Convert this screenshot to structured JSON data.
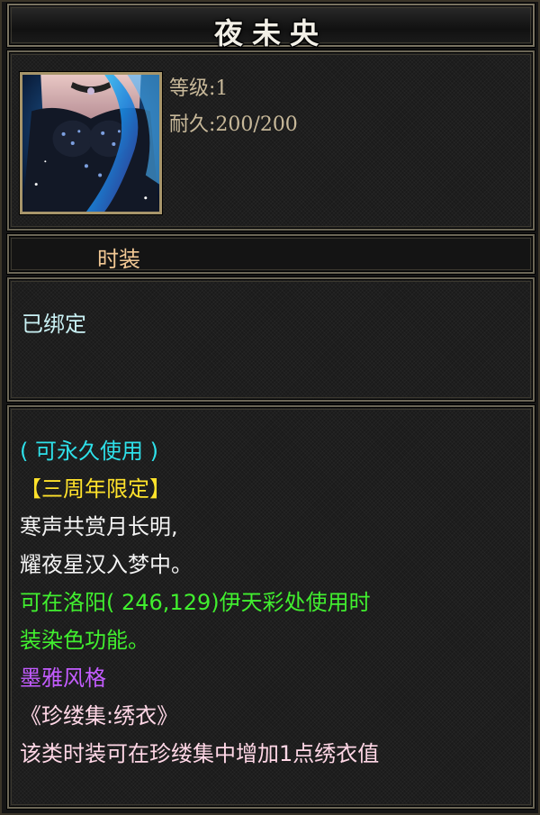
{
  "item": {
    "name": "夜未央",
    "level": "等级:1",
    "durability": "耐久:200/200",
    "category": "时装",
    "bind_status": "已绑定"
  },
  "description": {
    "usage": "( 可永久使用 )",
    "limited": "【三周年限定】",
    "poem_line_1": "寒声共赏月长明,",
    "poem_line_2": "耀夜星汉入梦中。",
    "dye_line_1": "可在洛阳( 246,129)伊天彩处使用时",
    "dye_line_2": "装染色功能。",
    "style": "墨雅风格",
    "collection": "《珍缕集:绣衣》",
    "collection_effect": "该类时装可在珍缕集中增加1点绣衣值"
  },
  "colors": {
    "usage": "#2ee1ea",
    "limited": "#ffe22b",
    "poem": "#f3f3f3",
    "dye": "#41ef2f",
    "style": "#c35cff",
    "collection": "#ffd7e6",
    "bind": "#c9f1f4",
    "category": "#f2c894",
    "stats": "#c8b99a"
  },
  "icons": {
    "item_portrait": "fashion-costume-portrait-icon"
  }
}
